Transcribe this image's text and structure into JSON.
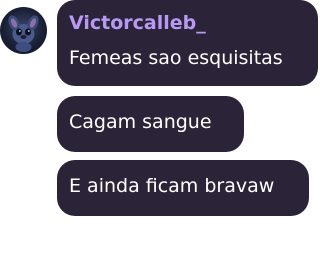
{
  "post": {
    "username": "Victorcalleb_",
    "avatar_icon": "stitch-avatar",
    "messages": [
      "Femeas sao esquisitas",
      "Cagam sangue",
      "E ainda ficam bravaw"
    ]
  },
  "colors": {
    "bubble": "#2b2438",
    "username": "#b89af5",
    "text": "#ffffff"
  }
}
